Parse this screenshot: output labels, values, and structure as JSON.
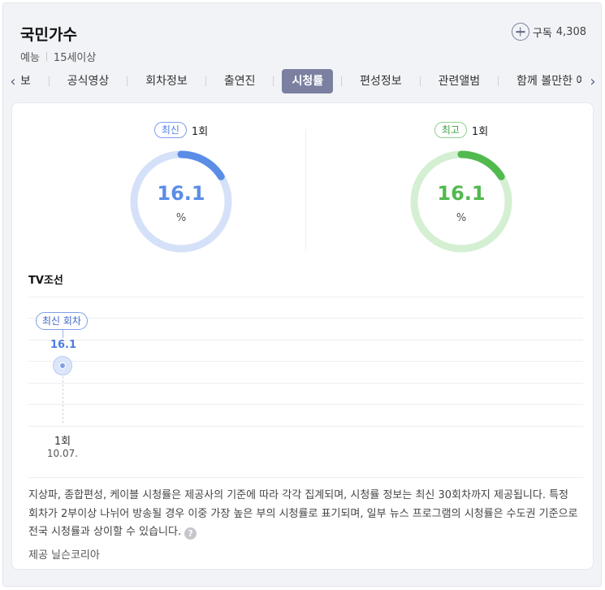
{
  "header": {
    "title": "국민가수",
    "genre": "예능",
    "rating": "15세이상",
    "subscribe_label": "구독",
    "subscribe_count": "4,308"
  },
  "tabs": [
    {
      "label": "정보",
      "active": false
    },
    {
      "label": "공식영상",
      "active": false
    },
    {
      "label": "회차정보",
      "active": false
    },
    {
      "label": "출연진",
      "active": false
    },
    {
      "label": "시청률",
      "active": true
    },
    {
      "label": "편성정보",
      "active": false
    },
    {
      "label": "관련앨범",
      "active": false
    },
    {
      "label": "함께 볼만한 예능",
      "active": false
    }
  ],
  "gauges": {
    "latest": {
      "badge": "최신",
      "episode": "1회",
      "value": "16.1",
      "unit": "%",
      "fill_percent": 16.1,
      "color": "#5b8de6",
      "track_color": "#d5e1f8"
    },
    "best": {
      "badge": "최고",
      "episode": "1회",
      "value": "16.1",
      "unit": "%",
      "fill_percent": 16.1,
      "color": "#52b94e",
      "track_color": "#d4efd2"
    }
  },
  "chart": {
    "broadcaster": "TV조선",
    "latest_tag": "최신 회차",
    "point_value": "16.1",
    "x_episode": "1회",
    "x_date": "10.07."
  },
  "chart_data": {
    "type": "line",
    "categories": [
      "1회"
    ],
    "x_dates": [
      "10.07."
    ],
    "values": [
      16.1
    ],
    "title": "TV조선",
    "xlabel": "",
    "ylabel": ""
  },
  "notice": {
    "text": "지상파, 종합편성, 케이블 시청률은 제공사의 기준에 따라 각각 집계되며, 시청률 정보는 최신 30회차까지 제공됩니다. 특정 회차가 2부이상 나뉘어 방송될 경우 이중 가장 높은 부의 시청률로 표기되며, 일부 뉴스 프로그램의 시청률은 수도권 기준으로 전국 시청률과 상이할 수 있습니다.",
    "provider": "제공 닐슨코리아"
  },
  "colors": {
    "accent": "#7b80a1",
    "blue": "#4c7ee0",
    "green": "#3fa33f"
  }
}
